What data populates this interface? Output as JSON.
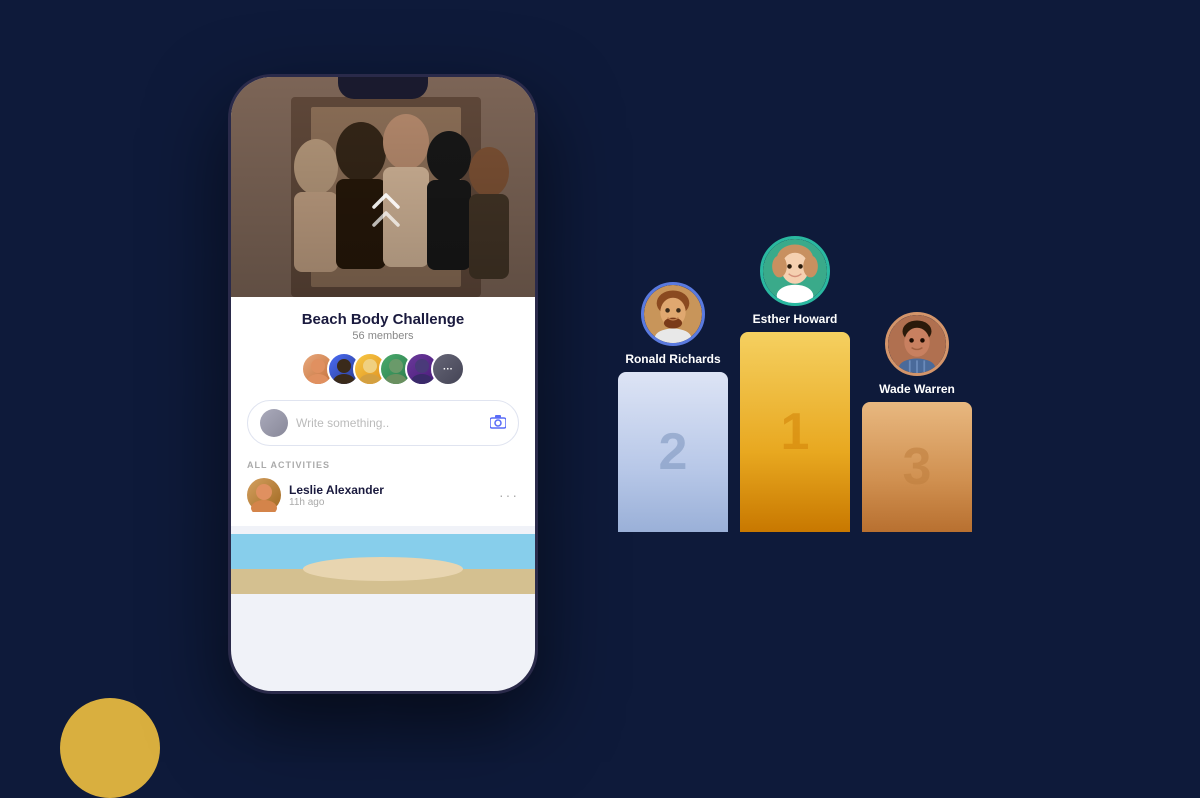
{
  "background_color": "#0e1a3a",
  "app": {
    "challenge": {
      "name": "Beach Body Challenge",
      "members": "56 members"
    },
    "write_placeholder": "Write something..",
    "activities_label": "ALL ACTIVITIES",
    "activity": {
      "name": "Leslie Alexander",
      "time": "11h ago"
    },
    "avatars": [
      {
        "id": "av1",
        "label": ""
      },
      {
        "id": "av2",
        "label": ""
      },
      {
        "id": "av3",
        "label": ""
      },
      {
        "id": "av4",
        "label": ""
      },
      {
        "id": "av5",
        "label": ""
      },
      {
        "id": "av-more",
        "label": "···"
      }
    ]
  },
  "leaderboard": {
    "first": {
      "name": "Esther Howard",
      "rank": "1",
      "rank_label": "1"
    },
    "second": {
      "name": "Ronald Richards",
      "rank": "2",
      "rank_label": "2"
    },
    "third": {
      "name": "Wade Warren",
      "rank": "3",
      "rank_label": "3"
    }
  }
}
